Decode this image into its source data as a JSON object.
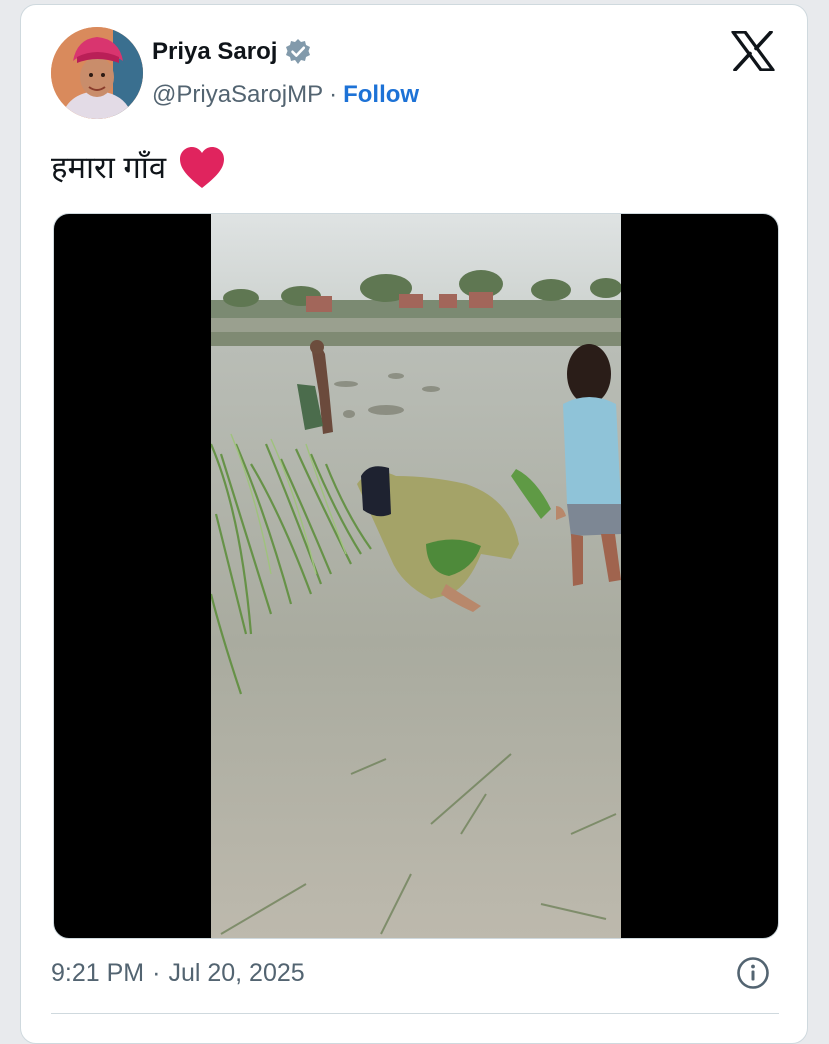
{
  "tweet": {
    "author": {
      "display_name": "Priya Saroj",
      "handle": "@PriyaSarojMP",
      "verified": true,
      "avatar_icon": "profile-photo"
    },
    "separator": "·",
    "follow_label": "Follow",
    "text": "हमारा गाँव",
    "emoji_icon": "red-heart-icon",
    "media": {
      "type": "video",
      "scene": "rice-paddy-field"
    },
    "time": "9:21 PM",
    "date": "Jul 20, 2025",
    "brand_icon": "x-logo-icon",
    "info_icon": "info-icon"
  },
  "colors": {
    "link": "#1d72d6",
    "text_primary": "#0f1419",
    "text_secondary": "#536471",
    "heart": "#e0245e",
    "border": "#cfd9de"
  }
}
